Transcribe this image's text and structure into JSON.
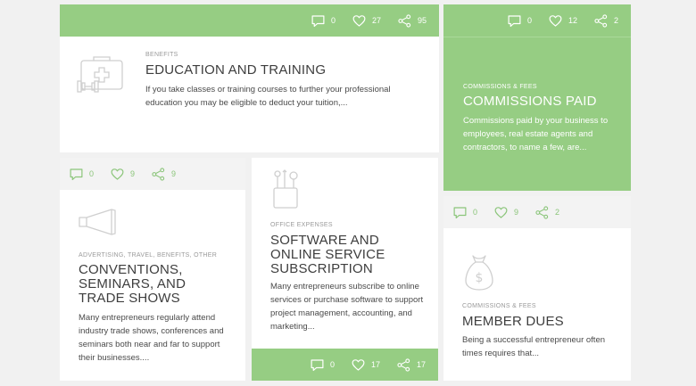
{
  "colors": {
    "accent": "#96cd83",
    "page_bg": "#f1f1f1",
    "card_bg": "#ffffff",
    "stat_bar_grey": "#f3f3f3"
  },
  "cards": [
    {
      "id": "education",
      "icon": "first-aid-kit-dumbbell-icon",
      "category": "BENEFITS",
      "title": "EDUCATION AND TRAINING",
      "description": "If you take classes or training courses to further your professional education you may be eligible to deduct your tuition,...",
      "comments": "0",
      "likes": "27",
      "shares": "95"
    },
    {
      "id": "commissions",
      "icon": "none",
      "category": "COMMISSIONS & FEES",
      "title": "COMMISSIONS PAID",
      "description": "Commissions paid by your business to employees, real estate agents and contractors, to name a few, are...",
      "comments": "0",
      "likes": "12",
      "shares": "2"
    },
    {
      "id": "conventions",
      "icon": "megaphone-icon",
      "category": "ADVERTISING, TRAVEL, BENEFITS, OTHER",
      "title": "CONVENTIONS, SEMINARS, AND TRADE SHOWS",
      "description": "Many entrepreneurs regularly attend industry trade shows, conferences and seminars both near and far to support their businesses....",
      "comments": "0",
      "likes": "9",
      "shares": "9"
    },
    {
      "id": "software",
      "icon": "pencil-cup-icon",
      "category": "OFFICE EXPENSES",
      "title": "SOFTWARE AND ONLINE SERVICE SUBSCRIPTION",
      "description": "Many entrepreneurs subscribe to online services or purchase software to support project management, accounting, and marketing...",
      "comments": "0",
      "likes": "17",
      "shares": "17"
    },
    {
      "id": "member-dues",
      "icon": "money-bag-icon",
      "category": "COMMISSIONS & FEES",
      "title": "MEMBER DUES",
      "description": "Being a successful entrepreneur often times requires that...",
      "comments": "0",
      "likes": "9",
      "shares": "2"
    }
  ]
}
